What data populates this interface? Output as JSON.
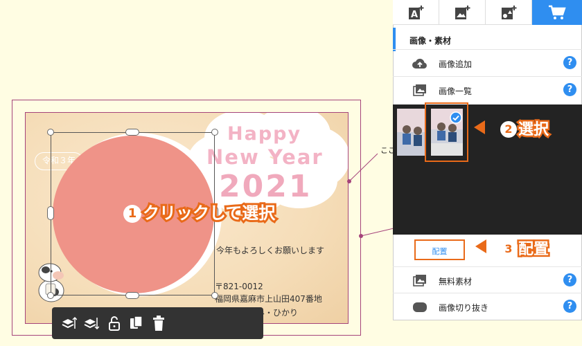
{
  "card": {
    "happy": "Happy",
    "new_year": "New Year",
    "year": "2021",
    "reiwa_badge": "令和３年",
    "greeting": "今年もよろしくお願いします",
    "postal": "〒821-0012",
    "address": "福岡県嘉麻市上山田407番地",
    "names": "花子・のぞみ・ひかり",
    "hint_text": "ここオン"
  },
  "annotations": {
    "step1_num": "1",
    "step1_label": "クリックして選択",
    "step2_num": "2",
    "step2_label": "選択",
    "step3_num": "3",
    "step3_label": "配置"
  },
  "toolbar": {
    "items": [
      "layer-up-icon",
      "layer-down-icon",
      "unlock-icon",
      "copy-icon",
      "trash-icon"
    ]
  },
  "panel": {
    "tabs": [
      "add-text-icon",
      "add-image-icon",
      "add-shape-icon",
      "cart-icon"
    ],
    "active_tab": 3,
    "section_title": "画像・素材",
    "rows": {
      "add_image": "画像追加",
      "image_list": "画像一覧",
      "place_button": "配置",
      "free_material": "無料素材",
      "crop_image": "画像切り抜き"
    },
    "help_label": "?"
  },
  "colors": {
    "accent": "#2f8ef0",
    "callout": "#e96a19",
    "card_border": "#a5437a",
    "circle": "#ef9388"
  }
}
